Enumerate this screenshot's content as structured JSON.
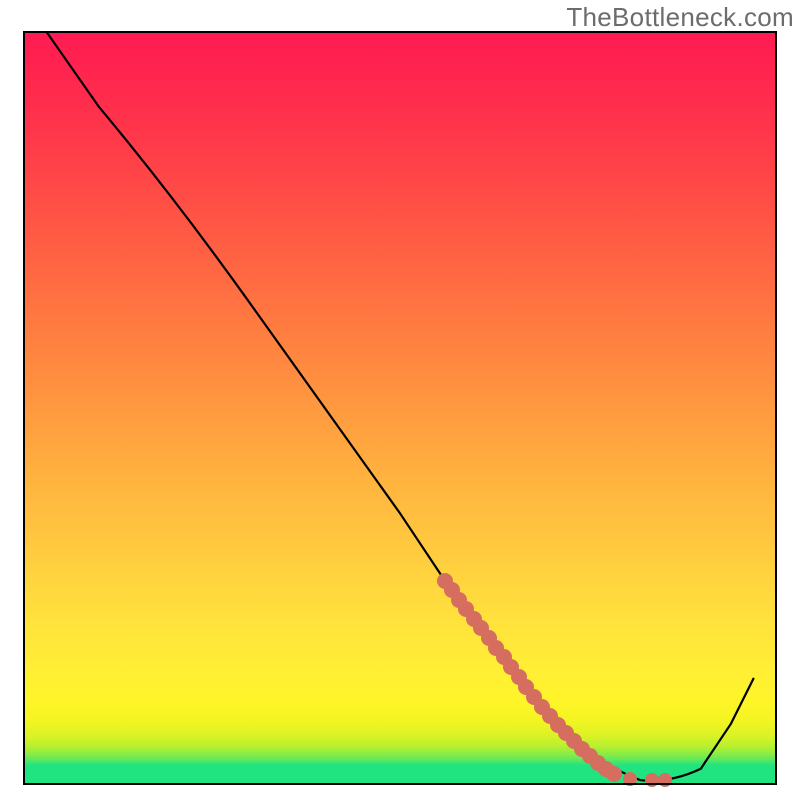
{
  "watermark": "TheBottleneck.com",
  "chart_data": {
    "type": "line",
    "title": "",
    "xlabel": "",
    "ylabel": "",
    "xlim": [
      0,
      100
    ],
    "ylim": [
      0,
      100
    ],
    "grid": false,
    "x": [
      3,
      10,
      20,
      30,
      40,
      50,
      56,
      60,
      66,
      70,
      74,
      78,
      82,
      86,
      90,
      94,
      97
    ],
    "y": [
      100,
      90,
      78,
      64,
      50,
      36,
      27,
      22,
      14,
      9,
      5,
      2,
      0.5,
      0.5,
      2,
      8,
      14
    ],
    "series": [
      {
        "name": "bottleneck-curve",
        "stroke": "#000000",
        "stroke_width": 2
      }
    ],
    "highlight": {
      "name": "optimal-range",
      "color": "#d66e60",
      "x_range": [
        56,
        82
      ],
      "points_x": [
        56,
        58,
        60,
        62,
        64,
        66,
        68,
        70,
        72,
        75,
        78,
        80,
        82
      ],
      "points_y": [
        27,
        24,
        22,
        19,
        16.5,
        14,
        11.5,
        9,
        7,
        4,
        2,
        1,
        0.5
      ]
    },
    "background_bands": [
      {
        "y_from": 0,
        "y_to": 3,
        "color": "#1fe47f"
      },
      {
        "y_from": 3,
        "y_to": 6,
        "color": "#6dea58"
      },
      {
        "y_from": 6,
        "y_to": 10,
        "color": "#b9f02f"
      },
      {
        "y_from": 10,
        "y_to": 16,
        "color": "#f5f61f"
      },
      {
        "y_from": 16,
        "y_to": 30,
        "color": "#fef03c"
      },
      {
        "y_from": 30,
        "y_to": 45,
        "color": "#ffc63f"
      },
      {
        "y_from": 45,
        "y_to": 60,
        "color": "#ff9a3f"
      },
      {
        "y_from": 60,
        "y_to": 75,
        "color": "#ff6d42"
      },
      {
        "y_from": 75,
        "y_to": 90,
        "color": "#ff4248"
      },
      {
        "y_from": 90,
        "y_to": 100,
        "color": "#ff2150"
      }
    ]
  }
}
